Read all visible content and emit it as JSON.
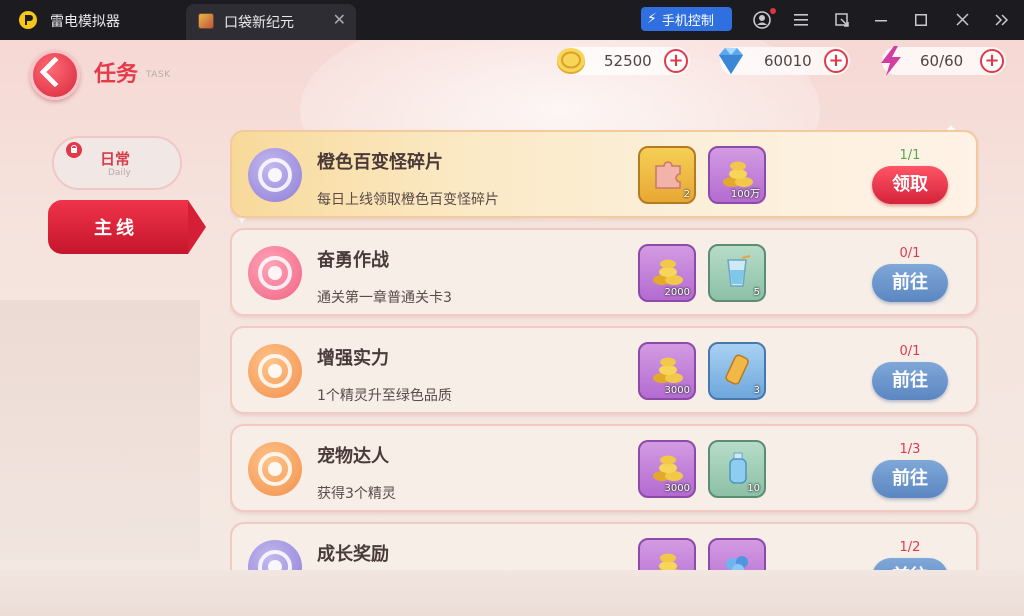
{
  "emulator": {
    "app_title": "雷电模拟器",
    "tab_label": "口袋新纪元",
    "tab_close": "✕",
    "phone_control": "手机控制"
  },
  "header": {
    "title": "任务",
    "subtitle": "TASK"
  },
  "currencies": [
    {
      "name": "coin",
      "value": "52500"
    },
    {
      "name": "diamond",
      "value": "60010"
    },
    {
      "name": "energy",
      "value": "60/60"
    }
  ],
  "sidebar": {
    "daily_label": "日常",
    "daily_sub": "Daily",
    "main_label": "主线"
  },
  "tasks": [
    {
      "name": "橙色百变怪碎片",
      "desc": "每日上线领取橙色百变怪碎片",
      "progress": "1/1",
      "button": "领取",
      "rewards": [
        {
          "qty": "2"
        },
        {
          "qty": "100万"
        }
      ]
    },
    {
      "name": "奋勇作战",
      "desc": "通关第一章普通关卡3",
      "progress": "0/1",
      "button": "前往",
      "rewards": [
        {
          "qty": "2000"
        },
        {
          "qty": "5"
        }
      ]
    },
    {
      "name": "增强实力",
      "desc": "1个精灵升至绿色品质",
      "progress": "0/1",
      "button": "前往",
      "rewards": [
        {
          "qty": "3000"
        },
        {
          "qty": "3"
        }
      ]
    },
    {
      "name": "宠物达人",
      "desc": "获得3个精灵",
      "progress": "1/3",
      "button": "前往",
      "rewards": [
        {
          "qty": "3000"
        },
        {
          "qty": "10"
        }
      ]
    },
    {
      "name": "成长奖励",
      "desc": "",
      "progress": "1/2",
      "button": "前往",
      "rewards": [
        {
          "qty": ""
        },
        {
          "qty": ""
        }
      ]
    }
  ]
}
